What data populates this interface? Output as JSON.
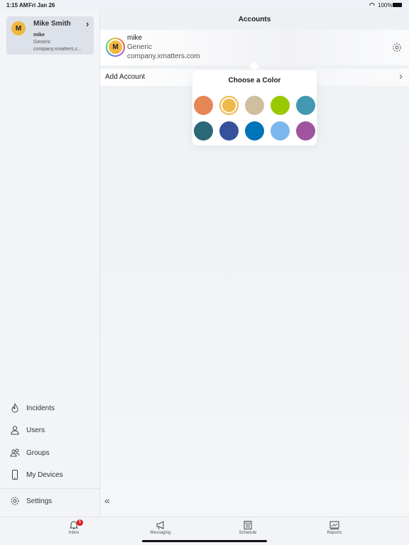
{
  "status_bar": {
    "time": "1:15 AM",
    "date": "Fri Jan 26",
    "battery": "100%"
  },
  "sidebar": {
    "account": {
      "initial": "M",
      "name": "Mike Smith",
      "username": "mike",
      "type": "Generic",
      "domain": "company.xmatters.c..."
    },
    "items": [
      {
        "label": "Incidents",
        "icon": "flame-icon"
      },
      {
        "label": "Users",
        "icon": "user-icon"
      },
      {
        "label": "Groups",
        "icon": "groups-icon"
      },
      {
        "label": "My Devices",
        "icon": "phone-icon"
      }
    ],
    "settings": "Settings"
  },
  "main": {
    "title": "Accounts",
    "account": {
      "initial": "M",
      "username": "mike",
      "type": "Generic",
      "domain": "company.xmatters.com"
    },
    "add_account": "Add Account"
  },
  "color_picker": {
    "title": "Choose a Color",
    "colors": [
      "#e58656",
      "#efb84a",
      "#cfbf9f",
      "#99c902",
      "#4299b1",
      "#2b6878",
      "#36529c",
      "#0074b9",
      "#7db6ec",
      "#a1549e"
    ],
    "selected": "#efb84a"
  },
  "tabbar": {
    "tabs": [
      {
        "label": "Inbox",
        "badge": "1"
      },
      {
        "label": "Messaging"
      },
      {
        "label": "Schedule"
      },
      {
        "label": "Reports"
      }
    ],
    "badge_color": "#e0161d"
  }
}
